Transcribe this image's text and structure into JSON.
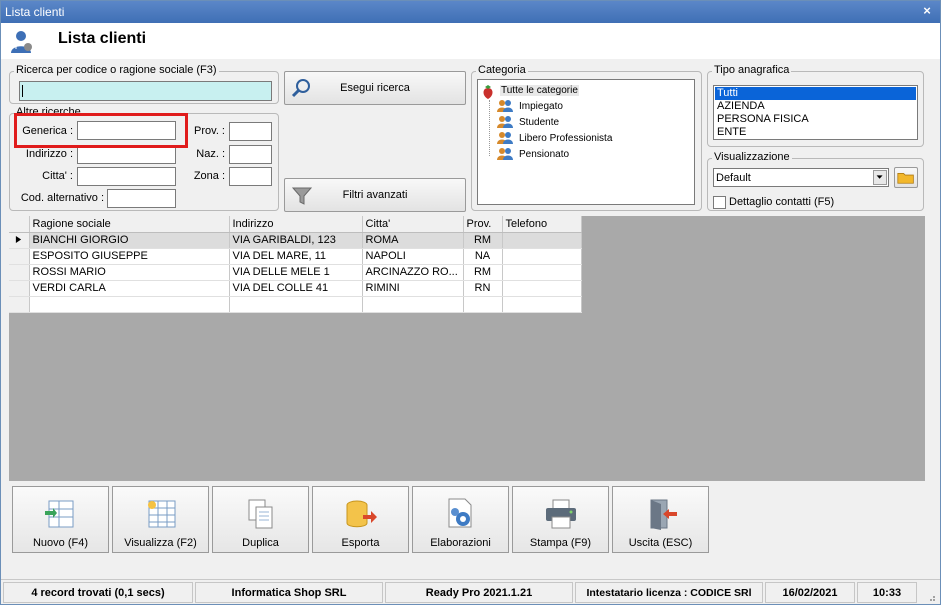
{
  "window": {
    "title": "Lista clienti",
    "close_glyph": "×"
  },
  "header": {
    "title": "Lista clienti",
    "icon": "users-icon"
  },
  "search": {
    "group_label": "Ricerca per codice o ragione sociale (F3)",
    "code_value": "",
    "search_button": "Esegui ricerca",
    "filters_button": "Filtri avanzati"
  },
  "other": {
    "group_label": "Altre ricerche",
    "generica_label": "Generica :",
    "indirizzo_label": "Indirizzo :",
    "citta_label": "Citta' :",
    "cod_alt_label": "Cod. alternativo :",
    "prov_label": "Prov. :",
    "naz_label": "Naz. :",
    "zona_label": "Zona :"
  },
  "categoria": {
    "group_label": "Categoria",
    "root": "Tutte le categorie",
    "items": [
      "Impiegato",
      "Studente",
      "Libero Professionista",
      "Pensionato"
    ]
  },
  "tipo": {
    "group_label": "Tipo anagrafica",
    "items": [
      "Tutti",
      "AZIENDA",
      "PERSONA FISICA",
      "ENTE"
    ],
    "selected": "Tutti"
  },
  "visualizzazione": {
    "group_label": "Visualizzazione",
    "value": "Default",
    "checkbox_label": "Dettaglio contatti (F5)",
    "checked": false
  },
  "grid": {
    "columns": [
      "Ragione sociale",
      "Indirizzo",
      "Citta'",
      "Prov.",
      "Telefono"
    ],
    "rows": [
      [
        "BIANCHI GIORGIO",
        "VIA GARIBALDI, 123",
        "ROMA",
        "RM",
        ""
      ],
      [
        "ESPOSITO GIUSEPPE",
        "VIA DEL MARE, 11",
        "NAPOLI",
        "NA",
        ""
      ],
      [
        "ROSSI MARIO",
        "VIA DELLE MELE 1",
        "ARCINAZZO RO...",
        "RM",
        ""
      ],
      [
        "VERDI CARLA",
        "VIA DEL COLLE 41",
        "RIMINI",
        "RN",
        ""
      ]
    ]
  },
  "actions": [
    {
      "label": "Nuovo (F4)",
      "icon": "new-row-icon"
    },
    {
      "label": "Visualizza (F2)",
      "icon": "view-grid-icon"
    },
    {
      "label": "Duplica",
      "icon": "duplicate-icon"
    },
    {
      "label": "Esporta",
      "icon": "export-icon"
    },
    {
      "label": "Elaborazioni",
      "icon": "process-icon"
    },
    {
      "label": "Stampa (F9)",
      "icon": "printer-icon"
    },
    {
      "label": "Uscita (ESC)",
      "icon": "exit-icon"
    }
  ],
  "status": {
    "records": "4 record trovati (0,1 secs)",
    "company": "Informatica Shop SRL",
    "version": "Ready Pro 2021.1.21",
    "license": "Intestatario licenza : CODICE SRl",
    "date": "16/02/2021",
    "time": "10:33"
  },
  "colors": {
    "highlight": "#e01b1b",
    "search_field": "#c8f0f0",
    "selection": "#0a64d8"
  }
}
